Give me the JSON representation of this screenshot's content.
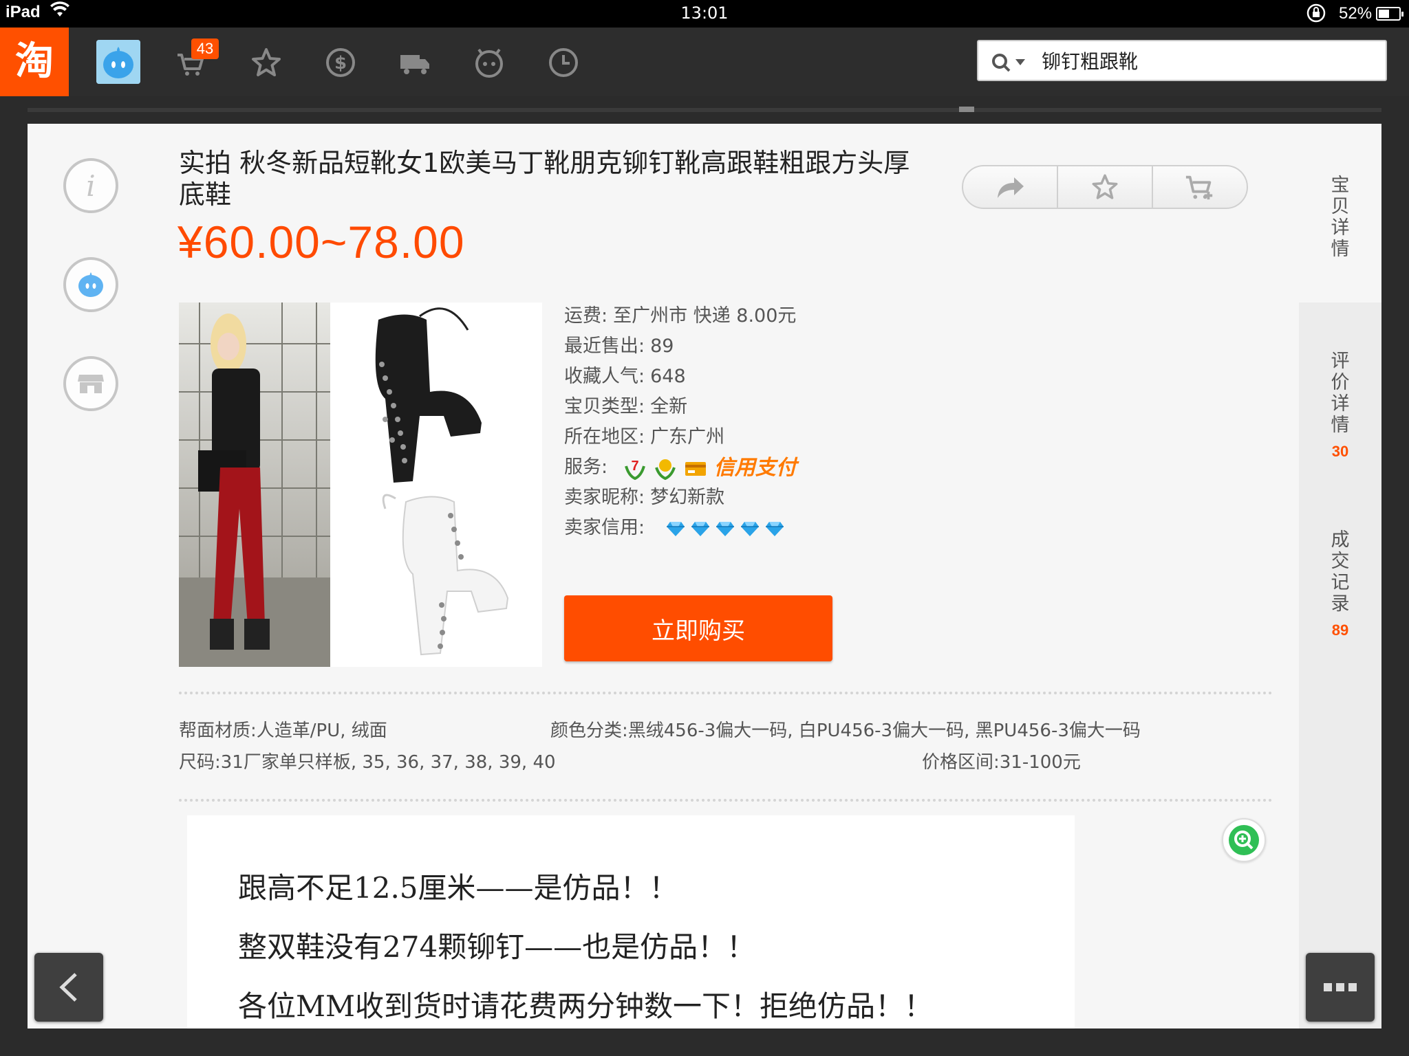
{
  "status_bar": {
    "device": "iPad",
    "time": "13:01",
    "battery": "52%",
    "battery_level": 0.52
  },
  "toolbar": {
    "logo": "淘",
    "cart_count": "43",
    "icons": [
      "avatar-icon",
      "cart-icon",
      "star-icon",
      "dollar-icon",
      "truck-icon",
      "face-icon",
      "clock-icon"
    ],
    "search": {
      "value": "铆钉粗跟靴",
      "placeholder": ""
    }
  },
  "product": {
    "title": "实拍 秋冬新品短靴女1欧美马丁靴朋克铆钉靴高跟鞋粗跟方头厚底鞋",
    "price": "¥60.00~78.00",
    "specs": [
      {
        "label": "运费:",
        "value": "至广州市 快递 8.00元"
      },
      {
        "label": "最近售出:",
        "value": "89"
      },
      {
        "label": "收藏人气:",
        "value": "648"
      },
      {
        "label": "宝贝类型:",
        "value": "全新"
      },
      {
        "label": "所在地区:",
        "value": "广东广州"
      }
    ],
    "service": {
      "label": "服务:",
      "credit_pay": "信用支付",
      "icons": [
        "seven-day-icon",
        "guarantee-icon",
        "card-icon"
      ]
    },
    "seller": {
      "nick_label": "卖家昵称:",
      "nick": "梦幻新款",
      "credit_label": "卖家信用:",
      "diamonds": 5
    },
    "buy_label": "立即购买",
    "attributes": {
      "material": "帮面材质:人造革/PU, 绒面",
      "color": "颜色分类:黑绒456-3偏大一码, 白PU456-3偏大一码, 黑PU456-3偏大一码",
      "size": "尺码:31厂家单只样板, 35, 36, 37, 38, 39, 40",
      "price_range": "价格区间:31-100元"
    },
    "description": [
      "跟高不足12.5厘米——是仿品！！",
      "整双鞋没有274颗铆钉——也是仿品！！",
      "各位MM收到货时请花费两分钟数一下！拒绝仿品！！"
    ]
  },
  "right_tabs": [
    {
      "label": "宝贝详情",
      "count": ""
    },
    {
      "label": "评价详情",
      "count": "30"
    },
    {
      "label": "成交记录",
      "count": "89"
    }
  ],
  "colors": {
    "accent": "#ff5000",
    "price": "#ff4a00",
    "buy": "#ff4d00"
  }
}
